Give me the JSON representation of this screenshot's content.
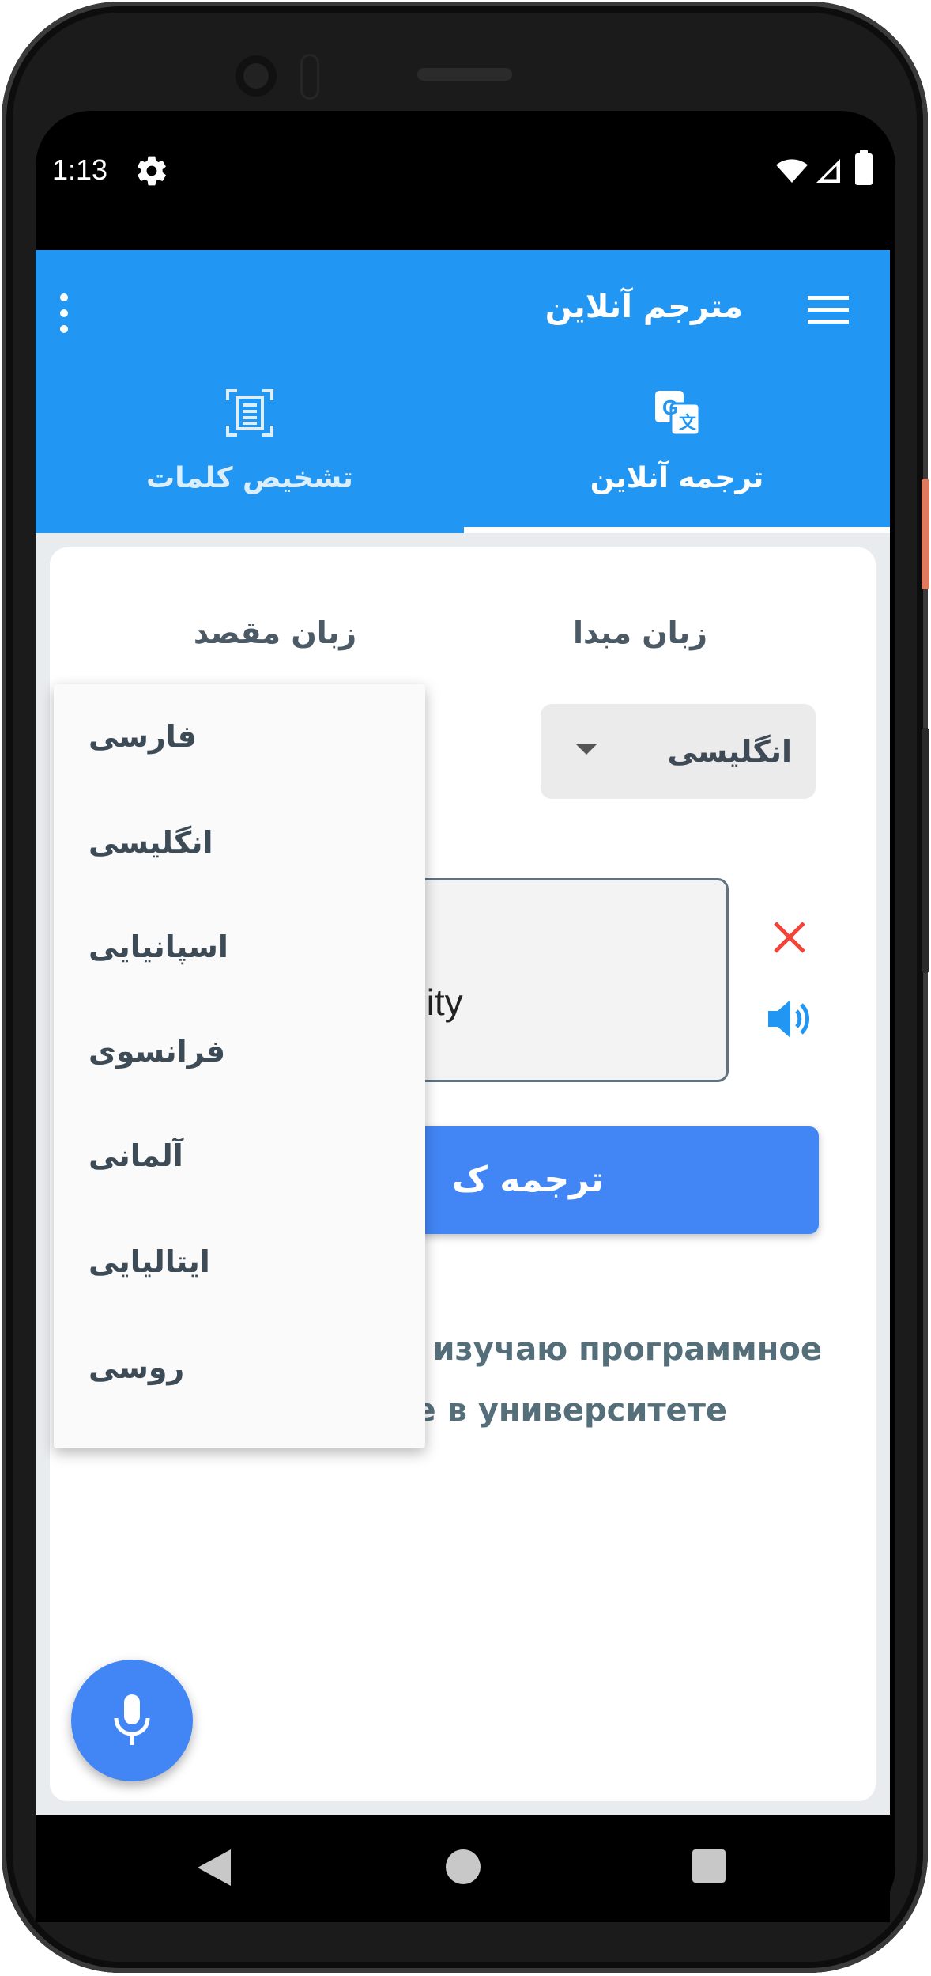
{
  "status_bar": {
    "time": "1:13",
    "icons": [
      "gear-icon",
      "wifi-icon",
      "signal-icon",
      "battery-icon"
    ]
  },
  "app_bar": {
    "title": "مترجم آنلاین",
    "menu_icon": "menu-icon",
    "overflow_icon": "more-vert-icon",
    "color": "#2196f3"
  },
  "tabs": [
    {
      "label": "تشخیص کلمات",
      "icon": "text-scan-icon",
      "selected": false
    },
    {
      "label": "ترجمه آنلاین",
      "icon": "translate-icon",
      "selected": true
    }
  ],
  "translator": {
    "source_label": "زبان مبدا",
    "target_label": "زبان مقصد",
    "source_value": "انگلیسی",
    "input_text": "I am currently studying software engineering at university",
    "input_visible_fragment": "ly studying\nuniversity",
    "translate_button_visible": "ترجمه ک",
    "result_visible": "я изучаю программное\nе в университете",
    "accent": "#4286f5"
  },
  "target_menu": {
    "items": [
      "فارسی",
      "انگلیسی",
      "اسپانیایی",
      "فرانسوی",
      "آلمانی",
      "ایتالیایی",
      "روسی"
    ]
  },
  "fab": {
    "icon": "mic-icon"
  },
  "nav": {
    "icons": [
      "back-icon",
      "home-icon",
      "recents-icon"
    ]
  }
}
